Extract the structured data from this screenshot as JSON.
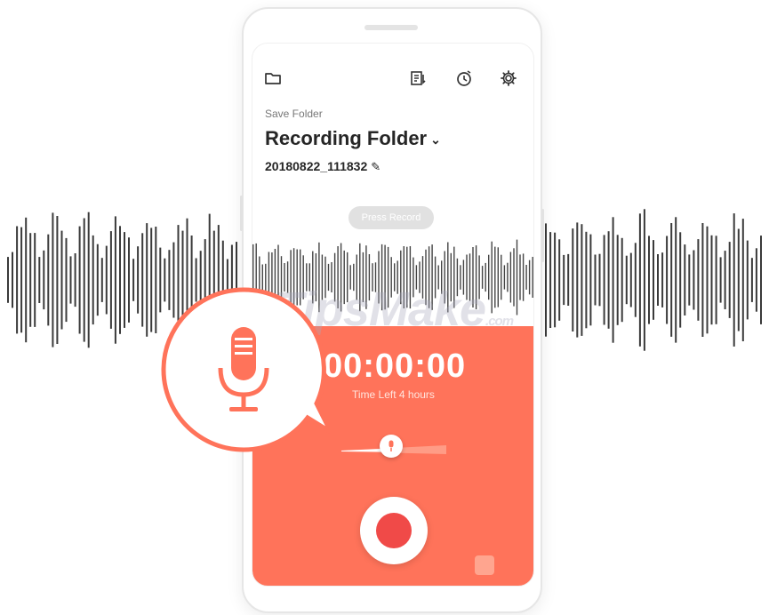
{
  "header": {
    "icons": [
      "folder-icon",
      "file-list-icon",
      "timer-icon",
      "settings-gear-icon"
    ]
  },
  "folder": {
    "save_label": "Save Folder",
    "title": "Recording Folder",
    "dropdown_icon": "chevron-down-icon",
    "file_name": "20180822_111832",
    "edit_icon": "pencil-icon"
  },
  "recording": {
    "press_record_label": "Press Record",
    "timer": "00:00:00",
    "time_left": "Time Left 4 hours",
    "mic_gain_icon": "microphone-icon",
    "record_button": "record-icon",
    "stop_button": "stop-icon"
  },
  "watermark": {
    "text": "TipsMake",
    "suffix": ".com"
  },
  "colors": {
    "accent": "#ff735a",
    "record": "#f04a48",
    "waveform": "#333333"
  }
}
